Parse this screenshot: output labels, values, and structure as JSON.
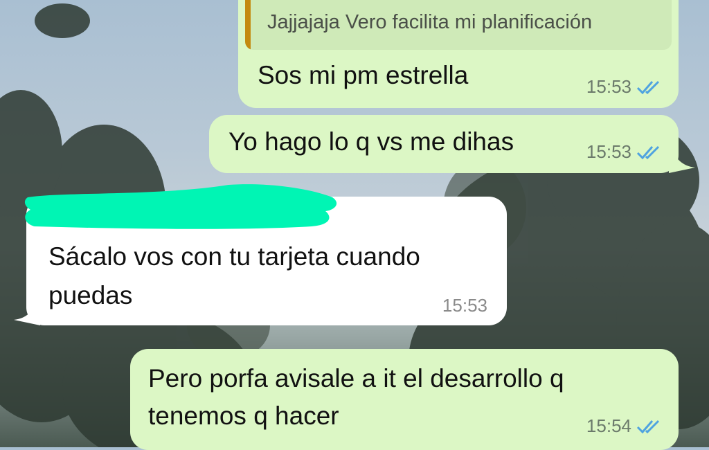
{
  "colors": {
    "outgoing_bubble": "#dcf7c5",
    "incoming_bubble": "#ffffff",
    "quote_background": "#cfeab8",
    "quote_bar": "#c48a10",
    "read_ticks": "#4fa3e0",
    "redaction": "#00f5b4"
  },
  "messages": [
    {
      "direction": "outgoing",
      "quote": "Jajjajaja Vero facilita mi planificación",
      "text": "Sos mi pm estrella",
      "time": "15:53",
      "status_icon": "double-check-read-icon"
    },
    {
      "direction": "outgoing",
      "text": "Yo hago lo q vs me dihas",
      "time": "15:53",
      "status_icon": "double-check-read-icon"
    },
    {
      "direction": "incoming",
      "sender_redacted": true,
      "text_line1": "Sácalo vos con tu tarjeta cuando",
      "text_line2": "puedas",
      "time": "15:53"
    },
    {
      "direction": "outgoing",
      "text_line1": "Pero porfa avisale a it el desarrollo q",
      "text_line2": "tenemos q hacer",
      "time": "15:54",
      "status_icon": "double-check-read-icon"
    }
  ]
}
